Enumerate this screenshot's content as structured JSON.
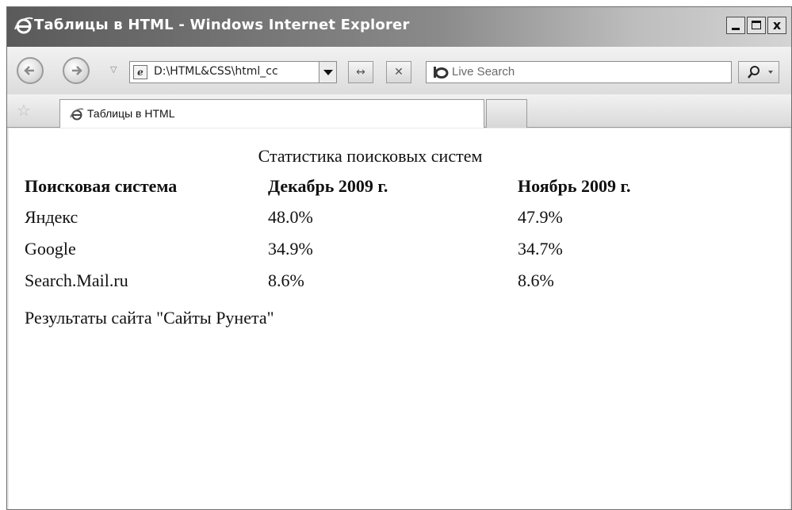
{
  "window": {
    "title": "Таблицы в HTML - Windows Internet Explorer",
    "minimize_icon": "minimize-icon",
    "maximize_icon": "maximize-icon",
    "close_label": "x"
  },
  "navigation": {
    "address": "D:\\HTML&CSS\\html_cc",
    "search_placeholder": "Live Search"
  },
  "favorites": {
    "tab_label": "Таблицы в HTML"
  },
  "page": {
    "caption": "Статистика поисковых систем",
    "headers": [
      "Поисковая система",
      "Декабрь 2009 г.",
      "Ноябрь 2009 г."
    ],
    "rows": [
      [
        "Яндекс",
        "48.0%",
        "47.9%"
      ],
      [
        "Google",
        "34.9%",
        "34.7%"
      ],
      [
        "Search.Mail.ru",
        "8.6%",
        "8.6%"
      ]
    ],
    "footnote": "Результаты сайта \"Сайты Рунета\""
  }
}
